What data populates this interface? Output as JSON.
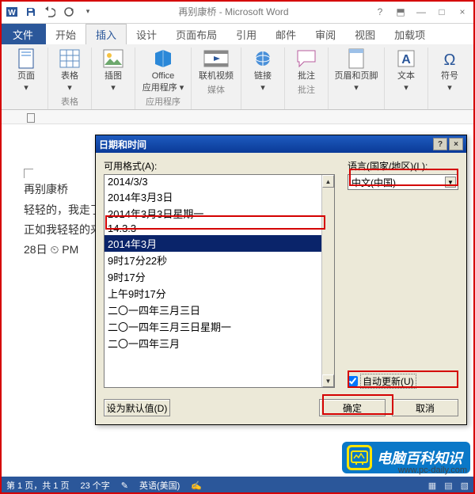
{
  "window": {
    "title": "再别康桥 - Microsoft Word"
  },
  "tabs": {
    "file": "文件",
    "home": "开始",
    "insert": "插入",
    "design": "设计",
    "layout": "页面布局",
    "references": "引用",
    "mailings": "邮件",
    "review": "审阅",
    "view": "视图",
    "addins": "加载项"
  },
  "ribbon": {
    "pages": {
      "page": "页面",
      "group": ""
    },
    "tables": {
      "table": "表格",
      "group": "表格"
    },
    "illustrations": {
      "illustration": "插图"
    },
    "apps": {
      "label1": "Office",
      "label2": "应用程序 ▾",
      "group": "应用程序"
    },
    "media": {
      "video": "联机视频",
      "group": "媒体"
    },
    "links": {
      "link": "链接"
    },
    "comments": {
      "comment": "批注",
      "group": "批注"
    },
    "headerfooter": {
      "hf": "页眉和页脚"
    },
    "text": {
      "text": "文本"
    },
    "symbols": {
      "symbol": "符号"
    }
  },
  "document": {
    "line1": "再别康桥",
    "line2": "轻轻的，我走了",
    "line3": "正如我轻轻的来",
    "line4": "28日   ⏲  PM"
  },
  "dialog": {
    "title": "日期和时间",
    "formats_label": "可用格式(A):",
    "language_label": "语言(国家/地区)(L):",
    "language_value": "中文(中国)",
    "auto_update": "自动更新(U)",
    "set_default": "设为默认值(D)",
    "ok": "确定",
    "cancel": "取消",
    "formats": [
      "2014/3/3",
      "2014年3月3日",
      "2014年3月3日星期一",
      "14.3.3",
      "2014年3月",
      "9时17分22秒",
      "9时17分",
      "上午9时17分",
      "二〇一四年三月三日",
      "二〇一四年三月三日星期一",
      "二〇一四年三月"
    ],
    "selected_index": 4
  },
  "status": {
    "page": "第 1 页，共 1 页",
    "words": "23 个字",
    "lang": "英语(美国)"
  },
  "brand": {
    "text": "电脑百科知识",
    "url": "www.pc-daily.com"
  }
}
